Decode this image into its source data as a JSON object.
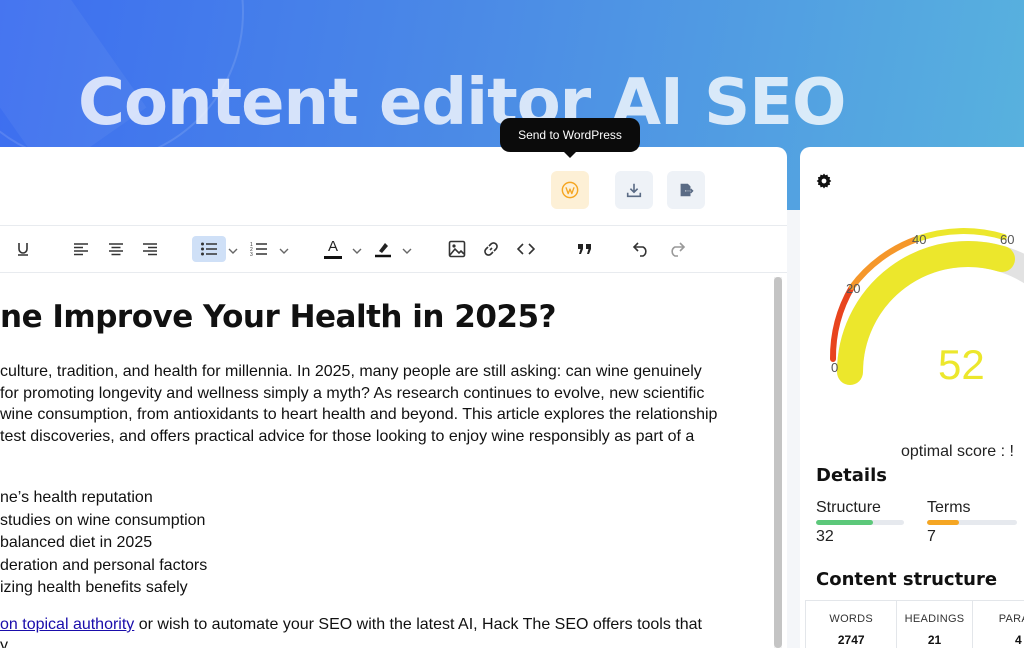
{
  "hero": {
    "title": "Content editor AI SEO"
  },
  "actions": {
    "tooltip": "Send to WordPress"
  },
  "colors": {
    "wordpress": "#f5a623",
    "score": "#ece72c",
    "structure": "#5cc87a",
    "terms": "#f5a623"
  },
  "toolbar": {
    "items": [
      "underline-icon",
      "align-left-icon",
      "align-center-icon",
      "align-right-icon",
      "bullet-list-icon",
      "numbered-list-icon",
      "text-color-icon",
      "highlight-icon",
      "image-icon",
      "link-icon",
      "code-icon",
      "quote-icon",
      "undo-icon",
      "redo-icon"
    ],
    "text_color_letter": "A"
  },
  "doc": {
    "heading": "ne Improve Your Health in 2025?",
    "paragraph": [
      "culture, tradition, and health for millennia. In 2025, many people are still asking: can wine genuinely",
      "for promoting longevity and wellness simply a myth? As research continues to evolve, new scientific",
      "wine consumption, from antioxidants to heart health and beyond. This article explores the relationship",
      "test discoveries, and offers practical advice for those looking to enjoy wine responsibly as part of a"
    ],
    "bullets": [
      "ne’s health reputation",
      "studies on wine consumption",
      "balanced diet in 2025",
      "deration and personal factors",
      "izing health benefits safely"
    ],
    "last_link": "on topical authority",
    "last_rest": " or wish to automate your SEO with the latest AI, Hack The SEO offers tools that",
    "last_line2": "y"
  },
  "panel": {
    "score": "52",
    "score_value": 52,
    "gauge_labels": [
      "0",
      "20",
      "40",
      "60"
    ],
    "optimal": "optimal score : !",
    "details_title": "Details",
    "metrics": [
      {
        "label": "Structure",
        "value": "32",
        "fill": 0.65
      },
      {
        "label": "Terms",
        "value": "7",
        "fill": 0.35
      }
    ],
    "content_structure_title": "Content structure",
    "stats": [
      {
        "label": "WORDS",
        "value": "2747"
      },
      {
        "label": "HEADINGS",
        "value": "21"
      },
      {
        "label": "PARAG",
        "value": "4"
      }
    ]
  }
}
